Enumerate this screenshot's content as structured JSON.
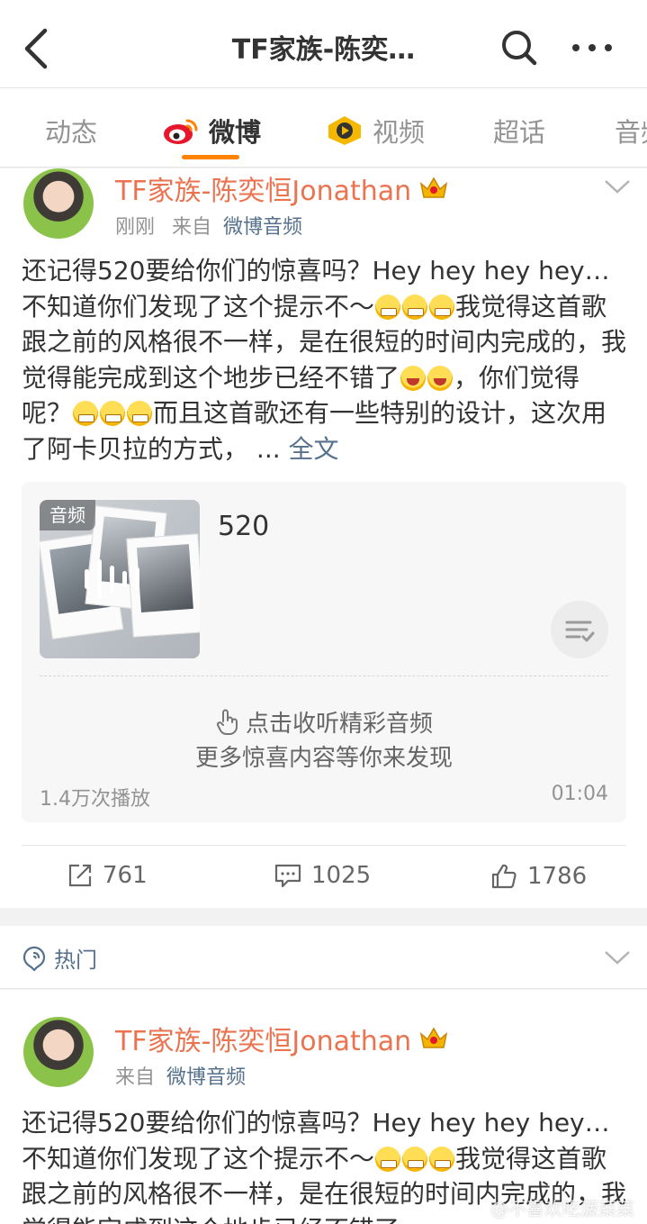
{
  "topbar": {
    "title": "TF家族-陈奕…"
  },
  "tabs": [
    "动态",
    "微博",
    "视频",
    "超话",
    "音频"
  ],
  "post1": {
    "author": "TF家族-陈奕恒Jonathan",
    "time": "刚刚",
    "from_label": "来自",
    "source": "微博音频",
    "text_a": "还记得520要给你们的惊喜吗？Hey hey hey hey… 不知道你们发现了这个提示不～",
    "text_b": "我觉得这首歌跟之前的风格很不一样，是在很短的时间内完成的，我觉得能完成到这个地步已经不错了",
    "text_c": "，你们觉得呢？",
    "text_d": "而且这首歌还有一些特别的设计，这次用了阿卡贝拉的方式，",
    "ellipsis": " ...",
    "full_link": "全文",
    "audio": {
      "badge": "音频",
      "title": "520",
      "tap_hint": "点击收听精彩音频",
      "more_hint": "更多惊喜内容等你来发现",
      "plays": "1.4万次播放",
      "duration": "01:04"
    },
    "actions": {
      "repost": "761",
      "comment": "1025",
      "like": "1786"
    }
  },
  "hot": {
    "label": "热门"
  },
  "post2": {
    "author": "TF家族-陈奕恒Jonathan",
    "from_label": "来自",
    "source": "微博音频",
    "text_a": "还记得520要给你们的惊喜吗？Hey hey hey hey… 不知道你们发现了这个提示不～",
    "text_b": "我觉得这首歌跟之前的风格很不一样，是在很短的时间内完成的，我觉得能完成到这个地步已经不错了"
  },
  "watermark": "@不喜欢吃菠菜菜",
  "colors": {
    "accent": "#ff8200",
    "author": "#eb7350",
    "link": "#55718d"
  }
}
